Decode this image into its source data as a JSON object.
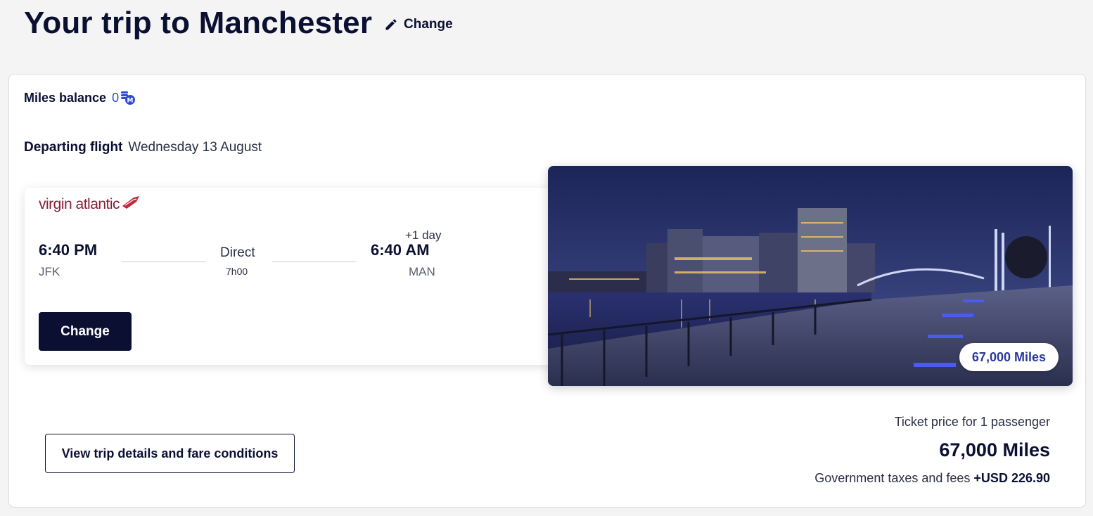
{
  "header": {
    "title": "Your trip to Manchester",
    "change_label": "Change"
  },
  "miles_balance": {
    "label": "Miles balance",
    "value": "0",
    "icon": "miles-coin-icon"
  },
  "departing": {
    "label": "Departing flight",
    "date": "Wednesday 13 August"
  },
  "flight": {
    "airline": "virgin atlantic",
    "departure_time": "6:40 PM",
    "departure_airport": "JFK",
    "stops": "Direct",
    "duration": "7h00",
    "day_offset": "+1 day",
    "arrival_time": "6:40 AM",
    "arrival_airport": "MAN",
    "change_button": "Change"
  },
  "hero": {
    "price_badge": "67,000 Miles"
  },
  "actions": {
    "details_button": "View trip details and fare conditions"
  },
  "pricing": {
    "ticket_for": "Ticket price for 1 passenger",
    "total": "67,000 Miles",
    "taxes_label": "Government taxes and fees",
    "taxes_value": "+USD 226.90"
  },
  "colors": {
    "navy": "#0b1033",
    "accent_blue": "#2f4bd6",
    "brand_red": "#8a1d3a"
  }
}
